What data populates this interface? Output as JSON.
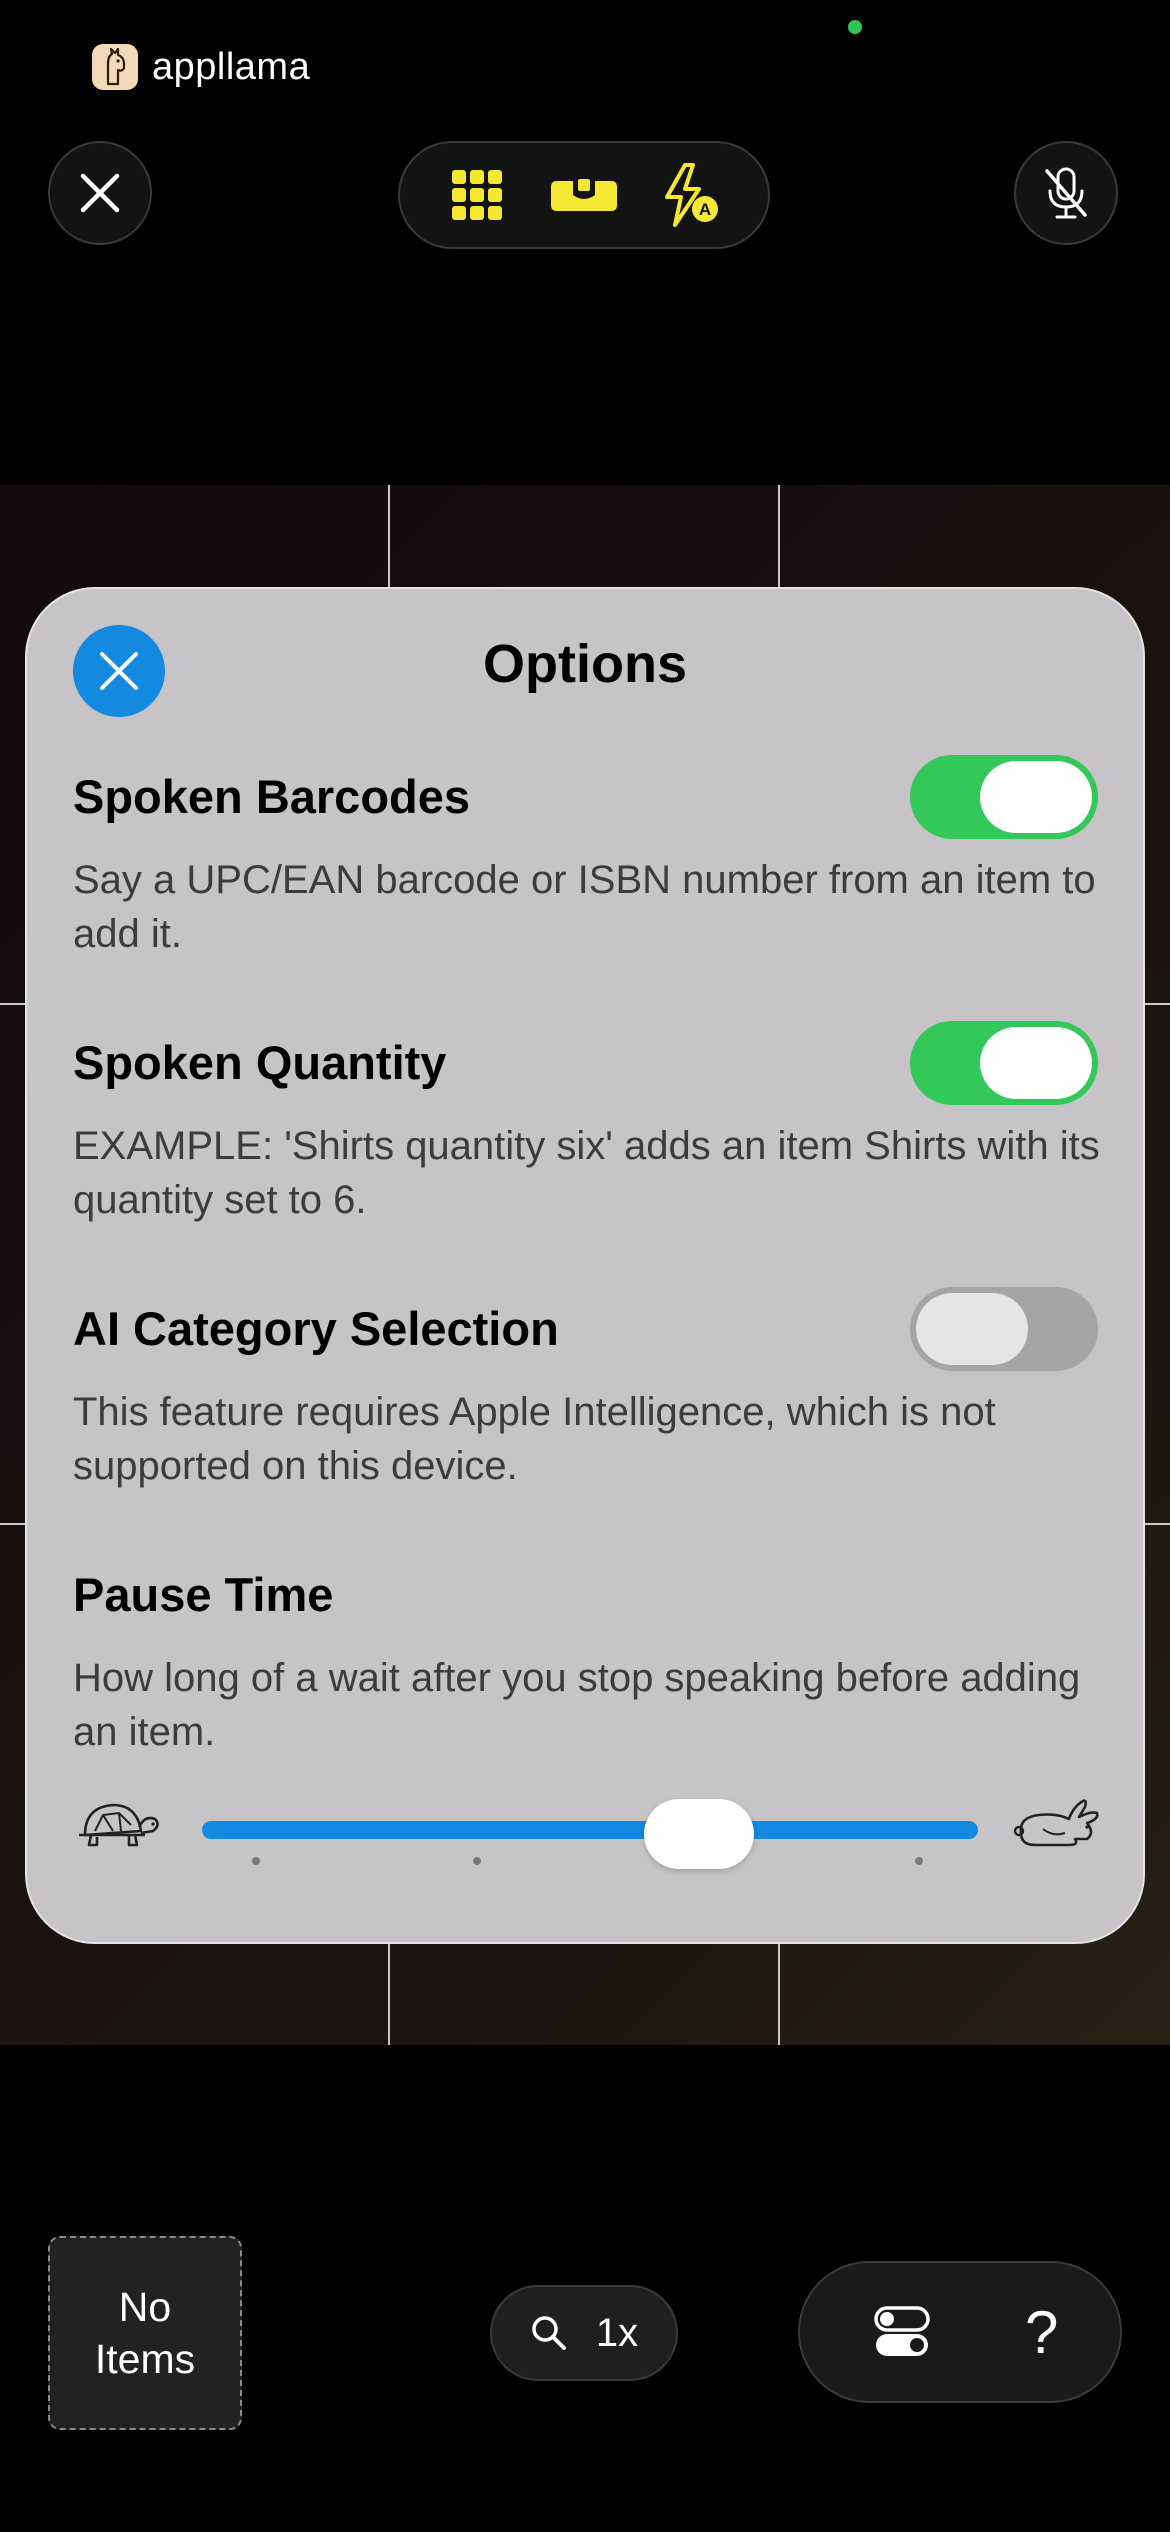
{
  "app": {
    "brand_name": "appllama"
  },
  "top_toolbar": {
    "close_icon": "close-icon",
    "icons": [
      "grid-icon",
      "level-icon",
      "flash-auto-icon"
    ],
    "flash_auto_badge": "A",
    "mic_icon": "mic-muted-icon",
    "accent_color": "#f5e832"
  },
  "options": {
    "title": "Options",
    "items": [
      {
        "title": "Spoken Barcodes",
        "description": "Say a UPC/EAN barcode or ISBN number from an item to add it.",
        "enabled": true
      },
      {
        "title": "Spoken Quantity",
        "description": "EXAMPLE: 'Shirts quantity six' adds an item Shirts with its quantity set to 6.",
        "enabled": true
      },
      {
        "title": "AI Category Selection",
        "description": "This feature requires Apple Intelligence, which is not supported on this device.",
        "enabled": false
      }
    ],
    "pause_time": {
      "title": "Pause Time",
      "description": "How long of a wait after you stop speaking before adding an item.",
      "slow_icon": "turtle-icon",
      "fast_icon": "rabbit-icon",
      "value_fraction": 0.63
    },
    "accent_color": "#1389e0",
    "toggle_on_color": "#34c759"
  },
  "bottom_bar": {
    "items_label": "No Items",
    "items_label_line1": "No",
    "items_label_line2": "Items",
    "zoom_label": "1x",
    "help_label": "?"
  }
}
